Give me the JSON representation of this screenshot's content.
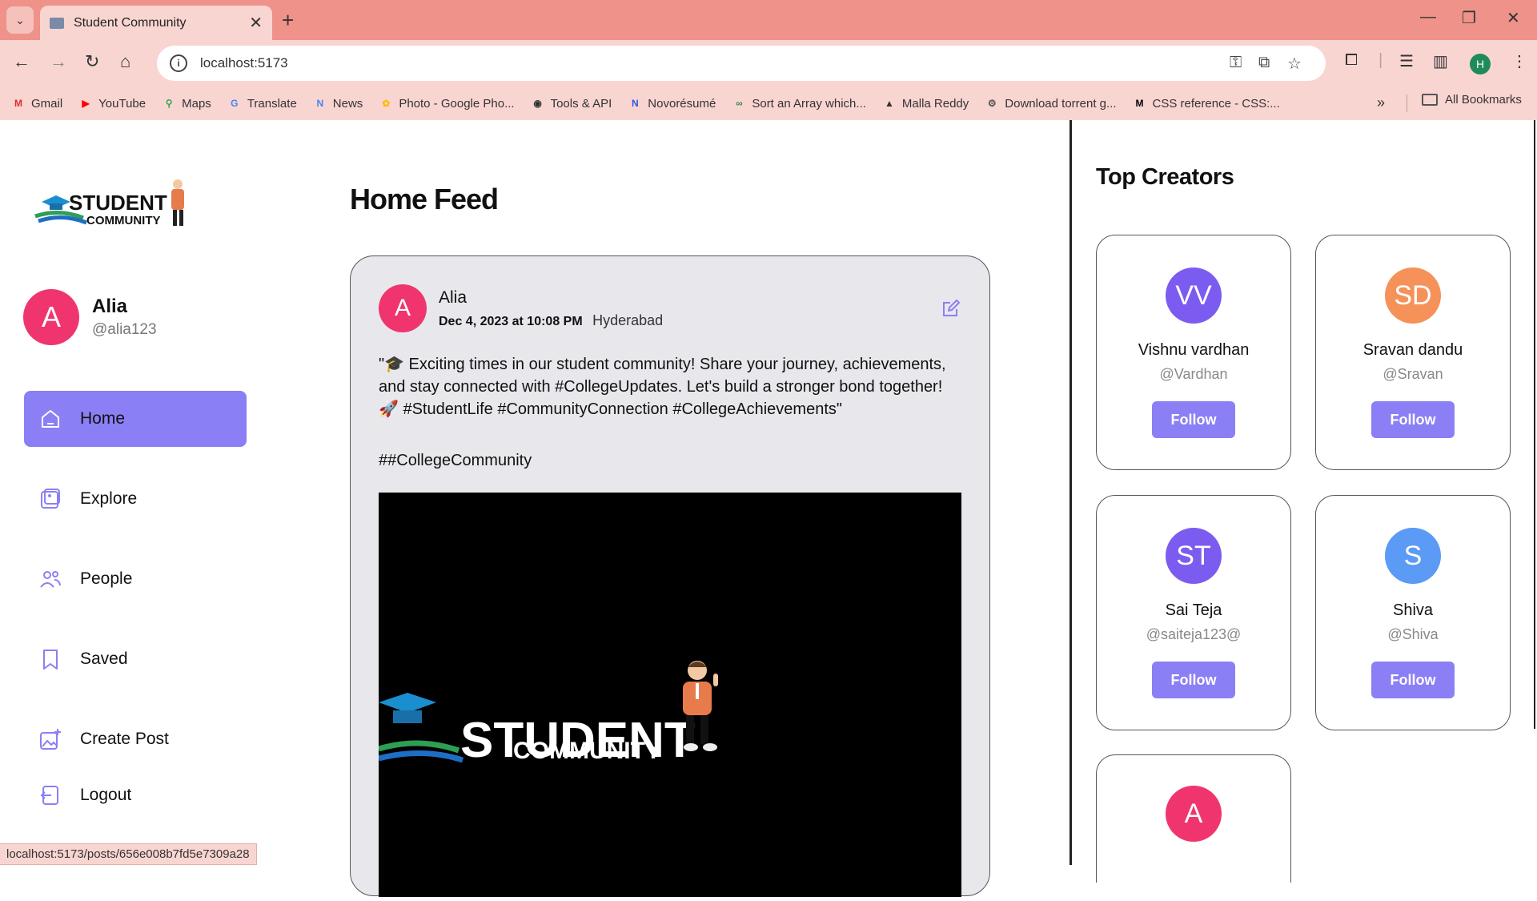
{
  "browser": {
    "tab_title": "Student Community",
    "url": "localhost:5173",
    "bookmarks": [
      {
        "label": "Gmail",
        "icon": "gmail-icon",
        "color": "#d93025",
        "glyph": "M"
      },
      {
        "label": "YouTube",
        "icon": "youtube-icon",
        "color": "#ff0000",
        "glyph": "▶"
      },
      {
        "label": "Maps",
        "icon": "maps-icon",
        "color": "#34a853",
        "glyph": "⚲"
      },
      {
        "label": "Translate",
        "icon": "translate-icon",
        "color": "#4285f4",
        "glyph": "G"
      },
      {
        "label": "News",
        "icon": "news-icon",
        "color": "#4285f4",
        "glyph": "N"
      },
      {
        "label": "Photo - Google Pho...",
        "icon": "photos-icon",
        "color": "#fbbc04",
        "glyph": "✿"
      },
      {
        "label": "Tools & API",
        "icon": "globe-icon",
        "color": "#333333",
        "glyph": "◉"
      },
      {
        "label": "Novorésumé",
        "icon": "novoresume-icon",
        "color": "#2a5bd7",
        "glyph": "N"
      },
      {
        "label": "Sort an Array which...",
        "icon": "gfg-icon",
        "color": "#2f8d46",
        "glyph": "∞"
      },
      {
        "label": "Malla Reddy",
        "icon": "malla-reddy-icon",
        "color": "#333333",
        "glyph": "▲"
      },
      {
        "label": "Download torrent g...",
        "icon": "torrent-icon",
        "color": "#555555",
        "glyph": "⚙"
      },
      {
        "label": "CSS reference - CSS:...",
        "icon": "mdn-icon",
        "color": "#000000",
        "glyph": "M"
      }
    ],
    "all_bookmarks": "All Bookmarks",
    "profile_initial": "H",
    "status_url": "localhost:5173/posts/656e008b7fd5e7309a28"
  },
  "sidebar": {
    "logo_top": "STUDENT",
    "logo_bottom": "COMMUNITY",
    "user": {
      "initial": "A",
      "name": "Alia",
      "handle": "@alia123"
    },
    "nav": [
      {
        "label": "Home",
        "icon": "home-icon",
        "active": true
      },
      {
        "label": "Explore",
        "icon": "explore-icon"
      },
      {
        "label": "People",
        "icon": "people-icon"
      },
      {
        "label": "Saved",
        "icon": "bookmark-icon"
      },
      {
        "label": "Create Post",
        "icon": "create-post-icon"
      },
      {
        "label": "Logout",
        "icon": "logout-icon"
      }
    ]
  },
  "feed": {
    "title": "Home Feed",
    "post": {
      "author_initial": "A",
      "author": "Alia",
      "date": "Dec 4, 2023 at 10:08 PM",
      "location": "Hyderabad",
      "text": "\"🎓 Exciting times in our student community! Share your journey, achievements, and stay connected with #CollegeUpdates. Let's build a stronger bond together! 🚀 #StudentLife #CommunityConnection #CollegeAchievements\"",
      "tags": "##CollegeCommunity",
      "image_logo_top": "STUDENT",
      "image_logo_bottom": "COMMUNITY"
    }
  },
  "top_creators": {
    "title": "Top Creators",
    "follow_label": "Follow",
    "creators": [
      {
        "initials": "VV",
        "name": "Vishnu vardhan",
        "handle": "@Vardhan",
        "color": "#7c5cf0"
      },
      {
        "initials": "SD",
        "name": "Sravan dandu",
        "handle": "@Sravan",
        "color": "#f5925a"
      },
      {
        "initials": "ST",
        "name": "Sai Teja",
        "handle": "@saiteja123@",
        "color": "#7c5cf0"
      },
      {
        "initials": "S",
        "name": "Shiva",
        "handle": "@Shiva",
        "color": "#5b9af5"
      },
      {
        "initials": "A",
        "name": "",
        "handle": "",
        "color": "#f0356e"
      }
    ]
  },
  "colors": {
    "accent": "#8b7ff5",
    "avatar_pink": "#f0356e",
    "chrome_tab": "#ee928a",
    "chrome_toolbar": "#f9d5d2"
  }
}
